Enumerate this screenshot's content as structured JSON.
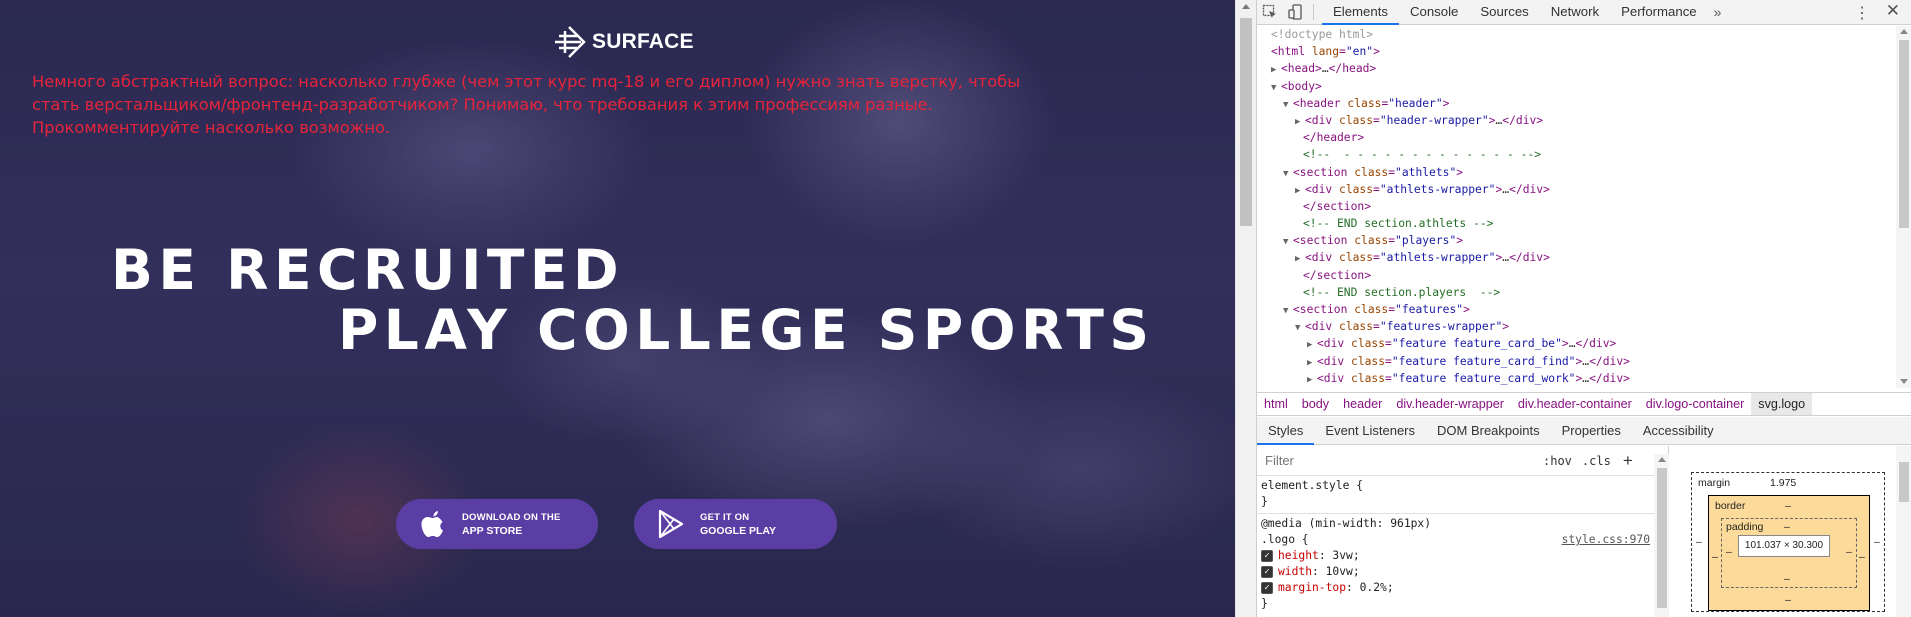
{
  "site": {
    "logo_text": "SURFACE",
    "question": "Немного абстрактный вопрос: насколько глубже (чем этот курс mq-18 и его диплом) нужно знать верстку, чтобы стать верстальщиком/фронтенд-разработчиком? Понимаю, что требования к этим профессиям разные. Прокомментируйте насколько возможно.",
    "question_color": "#e8233a",
    "hero_line1": "BE RECRUITED",
    "hero_line2": "PLAY COLLEGE SPORTS",
    "app_store": {
      "line1": "DOWNLOAD ON THE",
      "line2": "APP STORE",
      "icon": "apple-icon"
    },
    "google_play": {
      "line1": "GET IT ON",
      "line2": "GOOGLE PLAY",
      "icon": "google-play-icon"
    },
    "button_color": "#5b3ea3"
  },
  "devtools": {
    "tabs": [
      "Elements",
      "Console",
      "Sources",
      "Network",
      "Performance"
    ],
    "active_tab": "Elements",
    "more": "»",
    "kebab": "⋮",
    "close": "✕",
    "breadcrumbs": [
      "html",
      "body",
      "header",
      "div.header-wrapper",
      "div.header-container",
      "div.logo-container",
      "svg.logo"
    ],
    "sub_tabs": [
      "Styles",
      "Event Listeners",
      "DOM Breakpoints",
      "Properties",
      "Accessibility"
    ],
    "active_sub_tab": "Styles",
    "filter_placeholder": "Filter",
    "hov": ":hov",
    "cls": ".cls",
    "plus": "+",
    "element_style_open": "element.style {",
    "element_style_close": "}",
    "media_query": "@media (min-width: 961px)",
    "rule_selector": ".logo {",
    "rule_source": "style.css:970",
    "rule_props": [
      {
        "name": "height",
        "value": "3vw;"
      },
      {
        "name": "width",
        "value": "10vw;"
      },
      {
        "name": "margin-top",
        "value": "0.2%;"
      }
    ],
    "rule_close": "}",
    "box_model": {
      "margin_label": "margin",
      "margin_value": "1.975",
      "border_label": "border",
      "padding_label": "padding",
      "dash": "–",
      "content": "101.037 × 30.300"
    }
  }
}
